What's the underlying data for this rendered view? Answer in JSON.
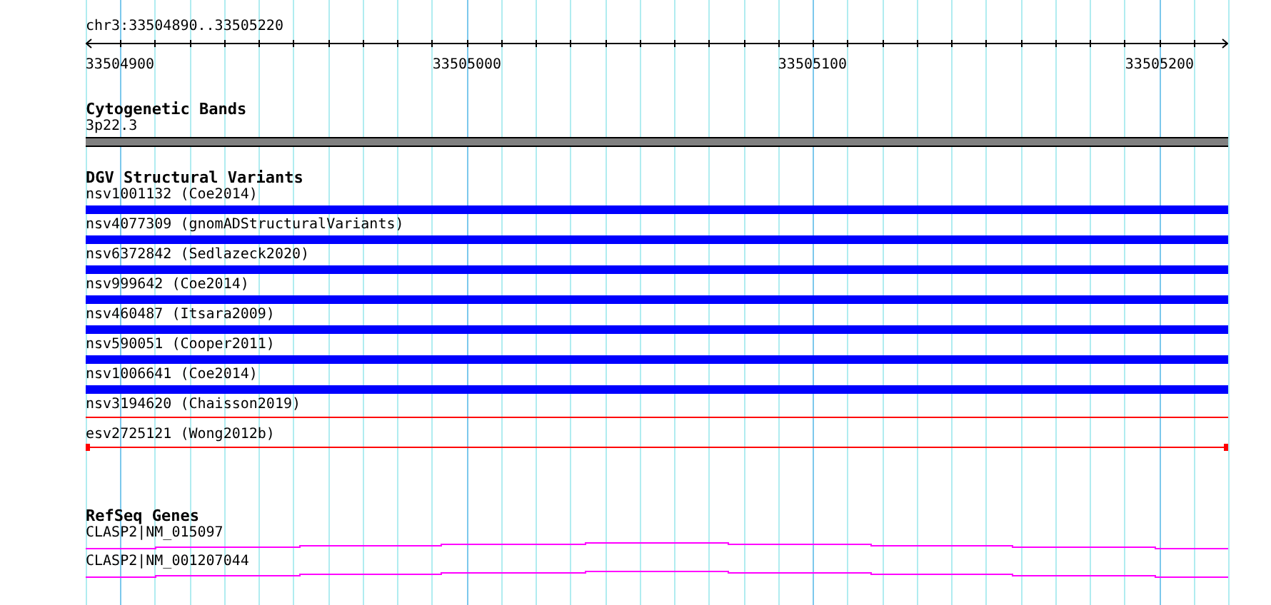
{
  "location": "chr3:33504890..33505220",
  "ruler": {
    "labels": [
      "33504900",
      "33505000",
      "33505100",
      "33505200"
    ]
  },
  "tracks": [
    {
      "kind": "band",
      "title": "Cytogenetic Bands",
      "features": [
        {
          "label": "3p22.3"
        }
      ]
    },
    {
      "kind": "variants",
      "title": "DGV Structural Variants",
      "features": [
        {
          "label": "nsv1001132 (Coe2014)",
          "kind": "bar",
          "color": "#0000ff"
        },
        {
          "label": "nsv4077309 (gnomADStructuralVariants)",
          "kind": "bar",
          "color": "#0000ff"
        },
        {
          "label": "nsv6372842 (Sedlazeck2020)",
          "kind": "bar",
          "color": "#0000ff"
        },
        {
          "label": "nsv999642 (Coe2014)",
          "kind": "bar",
          "color": "#0000ff"
        },
        {
          "label": "nsv460487 (Itsara2009)",
          "kind": "bar",
          "color": "#0000ff"
        },
        {
          "label": "nsv590051 (Cooper2011)",
          "kind": "bar",
          "color": "#0000ff"
        },
        {
          "label": "nsv1006641 (Coe2014)",
          "kind": "bar",
          "color": "#0000ff"
        },
        {
          "label": "nsv3194620 (Chaisson2019)",
          "kind": "line",
          "color": "#ff0000"
        },
        {
          "label": "esv2725121 (Wong2012b)",
          "kind": "line-ends",
          "color": "#ff0000"
        }
      ]
    },
    {
      "kind": "genes",
      "title": "RefSeq Genes",
      "features": [
        {
          "label": "CLASP2|NM_015097"
        },
        {
          "label": "CLASP2|NM_001207044"
        }
      ]
    }
  ]
}
